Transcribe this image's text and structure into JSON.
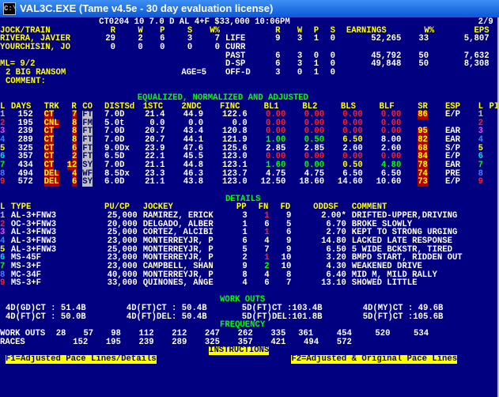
{
  "window": {
    "title": "VAL3C.EXE (Tame v4.5e - 30 day evaluation license)",
    "icon_text": "C:\\"
  },
  "header": {
    "race_line": "CT0204 10 7.0 D AL 4+F $33,000 10:06PM",
    "page": "2/9",
    "cols_left": [
      "JOCK/TRAIN",
      "R",
      "W",
      "P",
      "S",
      "W%"
    ],
    "cols_right": [
      "R",
      "W",
      "P",
      "S",
      "EARNINGS",
      "W%",
      "EPS"
    ],
    "jockey": {
      "name": "RIVERA, JAVIER",
      "r": "29",
      "w": "2",
      "p": "6",
      "s": "3",
      "wpct": "7"
    },
    "trainer": {
      "name": "YOURCHISIN, JO",
      "r": "0",
      "w": "0",
      "p": "0",
      "s": "0",
      "wpct": "0"
    },
    "stats": [
      {
        "label": "LIFE",
        "r": "9",
        "w": "3",
        "p": "1",
        "s": "0",
        "earn": "52,265",
        "wpct": "33",
        "eps": "5,807"
      },
      {
        "label": "CURR",
        "r": "",
        "w": "",
        "p": "",
        "s": "",
        "earn": "",
        "wpct": "",
        "eps": ""
      },
      {
        "label": "PAST",
        "r": "6",
        "w": "3",
        "p": "0",
        "s": "0",
        "earn": "45,792",
        "wpct": "50",
        "eps": "7,632"
      },
      {
        "label": "D-SP",
        "r": "6",
        "w": "3",
        "p": "1",
        "s": "0",
        "earn": "49,848",
        "wpct": "50",
        "eps": "8,308"
      },
      {
        "label": "OFF-D",
        "r": "3",
        "w": "0",
        "p": "1",
        "s": "0",
        "earn": "",
        "wpct": "",
        "eps": ""
      }
    ],
    "ml": "ML= 9/2",
    "horse": "2 BIG RANSOM",
    "age": "AGE=5",
    "comment_label": "COMMENT:"
  },
  "equalized": {
    "section_title": "EQUALIZED, NORMALIZED AND ADJUSTED",
    "columns": [
      "L",
      "DAYS",
      "TRK",
      "R",
      "CO",
      "DISTSd",
      "1STC",
      "2NDC",
      "FINC",
      "BL1",
      "BL2",
      "BLS",
      "BLF",
      "SR",
      "ESP",
      "L",
      "PI"
    ],
    "rows": [
      {
        "l": "1",
        "days": "152",
        "trk": "CT",
        "r": "7",
        "co": "FT",
        "dist": "7.0D",
        "c1": "21.4",
        "c2": "44.9",
        "fin": "122.6",
        "bl1": "0.00",
        "bl2": "0.00",
        "bls": "0.00",
        "blf": "0.00",
        "sr": "86",
        "esp": "E/P",
        "l2": "1",
        "pi": ""
      },
      {
        "l": "2",
        "days": "195",
        "trk": "CNL",
        "r": "8",
        "co": "FM",
        "dist": "5.0t",
        "c1": "0.0",
        "c2": "0.0",
        "fin": "0.0",
        "bl1": "0.00",
        "bl2": "0.00",
        "bls": "0.00",
        "blf": "0.00",
        "sr": "",
        "esp": "",
        "l2": "2",
        "pi": ""
      },
      {
        "l": "3",
        "days": "239",
        "trk": "CT",
        "r": "8",
        "co": "FT",
        "dist": "7.0D",
        "c1": "20.7",
        "c2": "43.4",
        "fin": "120.8",
        "bl1": "0.00",
        "bl2": "0.00",
        "bls": "0.00",
        "blf": "0.00",
        "sr": "95",
        "esp": "EAR",
        "l2": "3",
        "pi": ""
      },
      {
        "l": "4",
        "days": "289",
        "trk": "CT",
        "r": "8",
        "co": "FT",
        "dist": "7.0D",
        "c1": "20.7",
        "c2": "44.1",
        "fin": "121.9",
        "bl1": "1.00",
        "bl2": "0.50",
        "bls": "6.50",
        "blf": "8.00",
        "sr": "82",
        "esp": "EAR",
        "l2": "4",
        "pi": ""
      },
      {
        "l": "5",
        "days": "325",
        "trk": "CT",
        "r": "6",
        "co": "FT",
        "dist": "9.0Dx",
        "c1": "23.9",
        "c2": "47.6",
        "fin": "125.6",
        "bl1": "2.85",
        "bl2": "2.85",
        "bls": "2.60",
        "blf": "2.60",
        "sr": "68",
        "esp": "S/P",
        "l2": "5",
        "pi": ""
      },
      {
        "l": "6",
        "days": "357",
        "trk": "CT",
        "r": "2",
        "co": "FT",
        "dist": "6.5D",
        "c1": "22.1",
        "c2": "45.5",
        "fin": "123.0",
        "bl1": "0.00",
        "bl2": "0.00",
        "bls": "0.00",
        "blf": "0.00",
        "sr": "84",
        "esp": "E/P",
        "l2": "6",
        "pi": ""
      },
      {
        "l": "7",
        "days": "434",
        "trk": "CT",
        "r": "12",
        "co": "SY",
        "dist": "7.0D",
        "c1": "21.1",
        "c2": "44.8",
        "fin": "123.1",
        "bl1": "1.60",
        "bl2": "0.00",
        "bls": "0.50",
        "blf": "4.80",
        "sr": "78",
        "esp": "EAR",
        "l2": "7",
        "pi": ""
      },
      {
        "l": "8",
        "days": "494",
        "trk": "DEL",
        "r": "4",
        "co": "WF",
        "dist": "8.5Dx",
        "c1": "23.3",
        "c2": "46.3",
        "fin": "123.7",
        "bl1": "4.75",
        "bl2": "4.75",
        "bls": "6.50",
        "blf": "6.50",
        "sr": "74",
        "esp": "PRE",
        "l2": "8",
        "pi": ""
      },
      {
        "l": "9",
        "days": "572",
        "trk": "DEL",
        "r": "6",
        "co": "SY",
        "dist": "6.0D",
        "c1": "21.1",
        "c2": "43.8",
        "fin": "123.0",
        "bl1": "12.50",
        "bl2": "18.60",
        "bls": "14.60",
        "blf": "10.60",
        "sr": "73",
        "esp": "E/P",
        "l2": "9",
        "pi": ""
      }
    ]
  },
  "details": {
    "section_title": "DETAILS",
    "columns": [
      "L",
      "TYPE",
      "PU/CP",
      "JOCKEY",
      "PP",
      "FN",
      "FD",
      "ODDSF",
      "COMMENT"
    ],
    "rows": [
      {
        "l": "1",
        "type": "AL-3+FNW3",
        "pucp": "25,000",
        "jockey": "RAMIREZ, ERICK",
        "pp": "3",
        "fn": "1",
        "fd": "9",
        "odds": "2.00*",
        "comment": "DRIFTED-UPPER,DRIVING"
      },
      {
        "l": "2",
        "type": "OC-3+FNW3",
        "pucp": "20,000",
        "jockey": "DELGADO, ALBER",
        "pp": "1",
        "fn": "6",
        "fd": "5",
        "odds": "6.70",
        "comment": "BROKE SLOWLY"
      },
      {
        "l": "3",
        "type": "AL-3+FNW3",
        "pucp": "25,000",
        "jockey": "CORTEZ, ALCIBI",
        "pp": "1",
        "fn": "1",
        "fd": "6",
        "odds": "2.70",
        "comment": "KEPT TO STRONG URGING"
      },
      {
        "l": "4",
        "type": "AL-3+FNW3",
        "pucp": "23,000",
        "jockey": "MONTERREYJR, P",
        "pp": "6",
        "fn": "4",
        "fd": "9",
        "odds": "14.80",
        "comment": "LACKED LATE RESPONSE"
      },
      {
        "l": "5",
        "type": "AL-3+FNW3",
        "pucp": "25,000",
        "jockey": "MONTERREYJR, P",
        "pp": "5",
        "fn": "7",
        "fd": "9",
        "odds": "6.50",
        "comment": "5 WIDE BCKSTR, TIRED"
      },
      {
        "l": "6",
        "type": "MS-45F",
        "pucp": "23,000",
        "jockey": "MONTERREYJR, P",
        "pp": "2",
        "fn": "1",
        "fd": "10",
        "odds": "3.20",
        "comment": "BMPD START, RIDDEN OUT"
      },
      {
        "l": "7",
        "type": "MS-3+F",
        "pucp": "23,000",
        "jockey": "CAMPBELL, SHAN",
        "pp": "9",
        "fn": "2",
        "fd": "10",
        "odds": "4.30",
        "comment": "WEAKENED DRIVE"
      },
      {
        "l": "8",
        "type": "MC-34F",
        "pucp": "40,000",
        "jockey": "MONTERREYJR, P",
        "pp": "8",
        "fn": "4",
        "fd": "8",
        "odds": "6.40",
        "comment": "MID M, MILD RALLY"
      },
      {
        "l": "9",
        "type": "MS-3+F",
        "pucp": "33,000",
        "jockey": "QUINONES, ANGE",
        "pp": "4",
        "fn": "6",
        "fd": "7",
        "odds": "13.10",
        "comment": "SHOWED LITTLE"
      }
    ]
  },
  "workouts": {
    "section_title": "WORK OUTS",
    "row1": [
      "4D(GD)CT : 51.4B",
      "4D(FT)CT : 50.4B",
      "5D(FT)CT :103.4B",
      "4D(MY)CT : 49.6B"
    ],
    "row2": [
      "4D(FT)CT : 50.0B",
      "4D(FT)DEL: 50.4B",
      "5D(FT)DEL:101.8B",
      "5D(FT)CT :105.6B"
    ]
  },
  "frequency": {
    "section_title": "FREQUENCY",
    "workouts_label": "WORK OUTS",
    "workouts": [
      "28",
      "57",
      "98",
      "112",
      "212",
      "247",
      "262",
      "335",
      "361",
      "454",
      "520",
      "534"
    ],
    "races_label": "RACES",
    "races": [
      "152",
      "195",
      "239",
      "289",
      "325",
      "357",
      "421",
      "494",
      "572"
    ]
  },
  "instructions": {
    "section_title": "INSTRUCTIONS",
    "f1": "F1=Adjusted Pace Lines/Details",
    "f2": "F2=Adjusted & Original Pace Lines"
  },
  "colors": {
    "background": "#000080",
    "header_yellow": "#ffff00",
    "section_green": "#00ff00",
    "highlight_red": "#b00000"
  }
}
